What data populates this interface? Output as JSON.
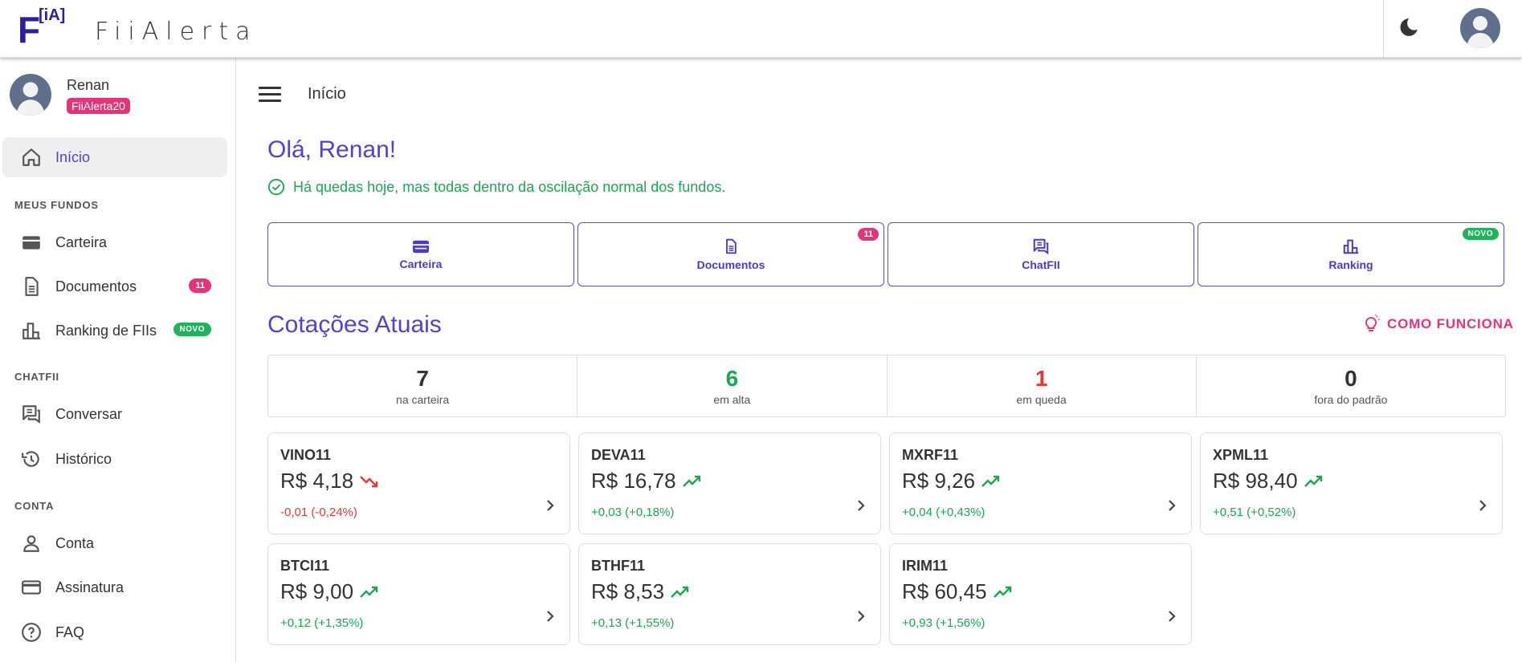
{
  "app": {
    "logo_letter": "F",
    "logo_superscript": "[iA]",
    "name": "FiiAlerta"
  },
  "colors": {
    "accent": "#5340d6",
    "pink": "#e8337c",
    "green": "#18a94f",
    "red": "#e53935"
  },
  "user": {
    "name": "Renan",
    "tag": "FiiAlerta20"
  },
  "sidebar": {
    "home": "Início",
    "section_funds": "MEUS FUNDOS",
    "carteira": "Carteira",
    "documentos": "Documentos",
    "documentos_badge": "11",
    "ranking": "Ranking de FIIs",
    "ranking_badge": "NOVO",
    "section_chat": "CHATFII",
    "conversar": "Conversar",
    "historico": "Histórico",
    "section_account": "CONTA",
    "conta": "Conta",
    "assinatura": "Assinatura",
    "faq": "FAQ"
  },
  "main": {
    "breadcrumb": "Início",
    "greeting": "Olá, Renan!",
    "alert": "Há quedas hoje, mas todas dentro da oscilação normal dos fundos.",
    "quick": {
      "carteira": "Carteira",
      "documentos": "Documentos",
      "documentos_badge": "11",
      "chatfii": "ChatFII",
      "ranking": "Ranking",
      "ranking_badge": "NOVO"
    },
    "section_title": "Cotações Atuais",
    "how_label": "COMO FUNCIONA",
    "stats": [
      {
        "value": "7",
        "label": "na carteira"
      },
      {
        "value": "6",
        "label": "em alta"
      },
      {
        "value": "1",
        "label": "em queda"
      },
      {
        "value": "0",
        "label": "fora do padrão"
      }
    ],
    "funds": [
      {
        "ticker": "VINO11",
        "price": "R$ 4,18",
        "change": "-0,01 (-0,24%)",
        "trend": "down"
      },
      {
        "ticker": "DEVA11",
        "price": "R$ 16,78",
        "change": "+0,03 (+0,18%)",
        "trend": "up"
      },
      {
        "ticker": "MXRF11",
        "price": "R$ 9,26",
        "change": "+0,04 (+0,43%)",
        "trend": "up"
      },
      {
        "ticker": "XPML11",
        "price": "R$ 98,40",
        "change": "+0,51 (+0,52%)",
        "trend": "up"
      },
      {
        "ticker": "BTCI11",
        "price": "R$ 9,00",
        "change": "+0,12 (+1,35%)",
        "trend": "up"
      },
      {
        "ticker": "BTHF11",
        "price": "R$ 8,53",
        "change": "+0,13 (+1,55%)",
        "trend": "up"
      },
      {
        "ticker": "IRIM11",
        "price": "R$ 60,45",
        "change": "+0,93 (+1,56%)",
        "trend": "up"
      }
    ]
  }
}
